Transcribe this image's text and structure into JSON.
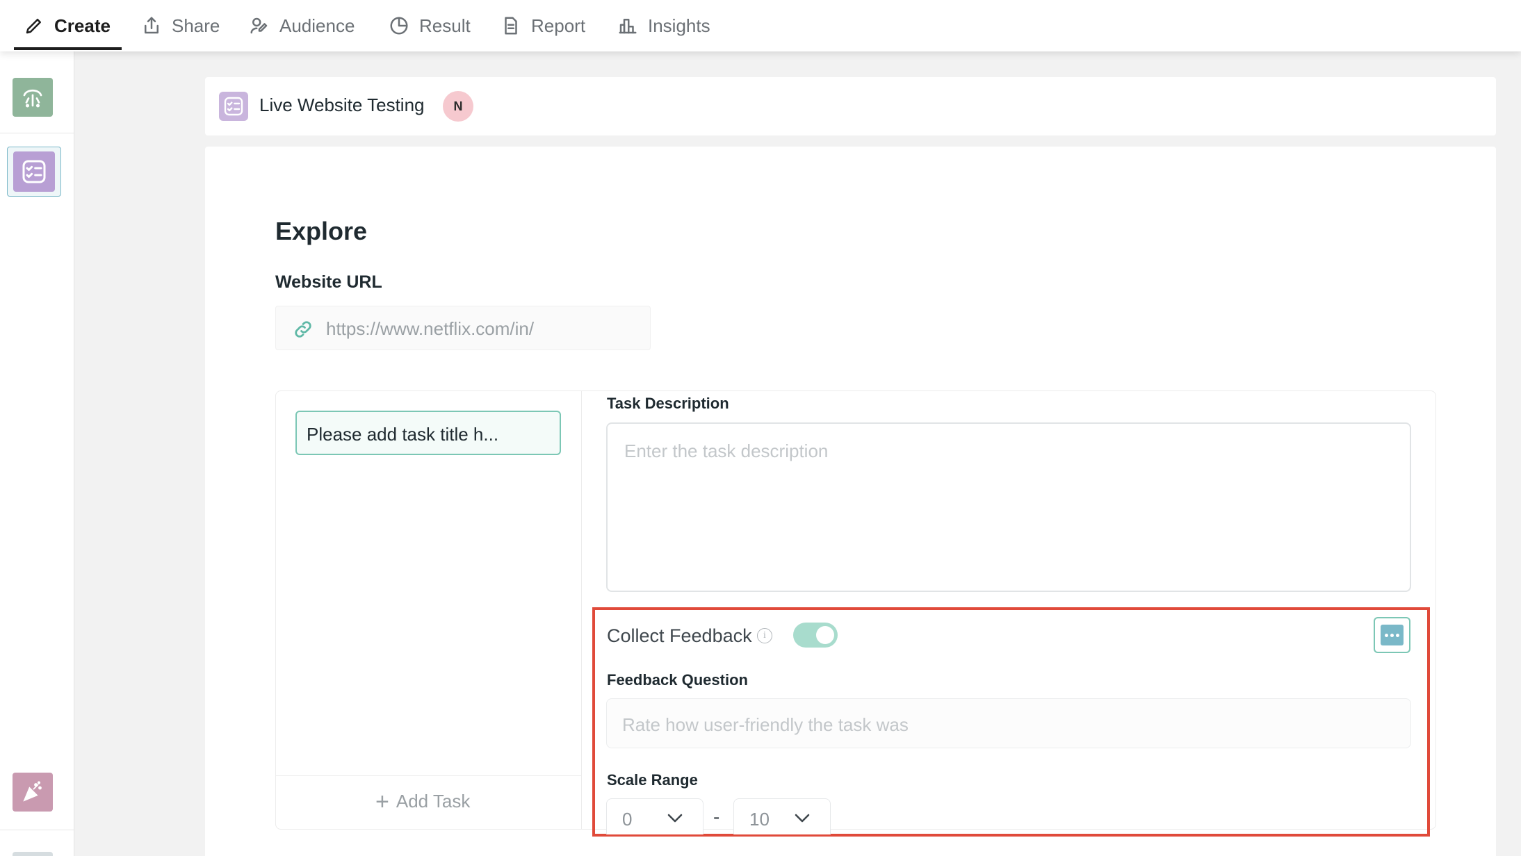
{
  "nav": {
    "tabs": [
      {
        "label": "Create",
        "icon": "pencil-icon",
        "active": true
      },
      {
        "label": "Share",
        "icon": "share-icon"
      },
      {
        "label": "Audience",
        "icon": "audience-icon"
      },
      {
        "label": "Result",
        "icon": "pie-chart-icon"
      },
      {
        "label": "Report",
        "icon": "document-icon"
      },
      {
        "label": "Insights",
        "icon": "bar-chart-icon"
      }
    ]
  },
  "header": {
    "title": "Live Website Testing",
    "badge": "N"
  },
  "explore": {
    "title": "Explore",
    "url_label": "Website URL",
    "url_value": "https://www.netflix.com/in/"
  },
  "tasks": {
    "task_title_value": "Please add task title h...",
    "add_task_label": "Add Task",
    "description_label": "Task Description",
    "description_placeholder": "Enter the task description"
  },
  "feedback": {
    "label": "Collect Feedback",
    "enabled": true,
    "question_label": "Feedback Question",
    "question_placeholder": "Rate how user-friendly the task was",
    "scale_label": "Scale Range",
    "scale_min": "0",
    "scale_separator": "-",
    "scale_max": "10"
  },
  "colors": {
    "accent": "#7cc7b5",
    "toggle_on": "#a8dccd",
    "highlight": "#e04a3a",
    "badge_bg": "#f6c9cf",
    "task_icon_bg": "#c9b5dd"
  }
}
